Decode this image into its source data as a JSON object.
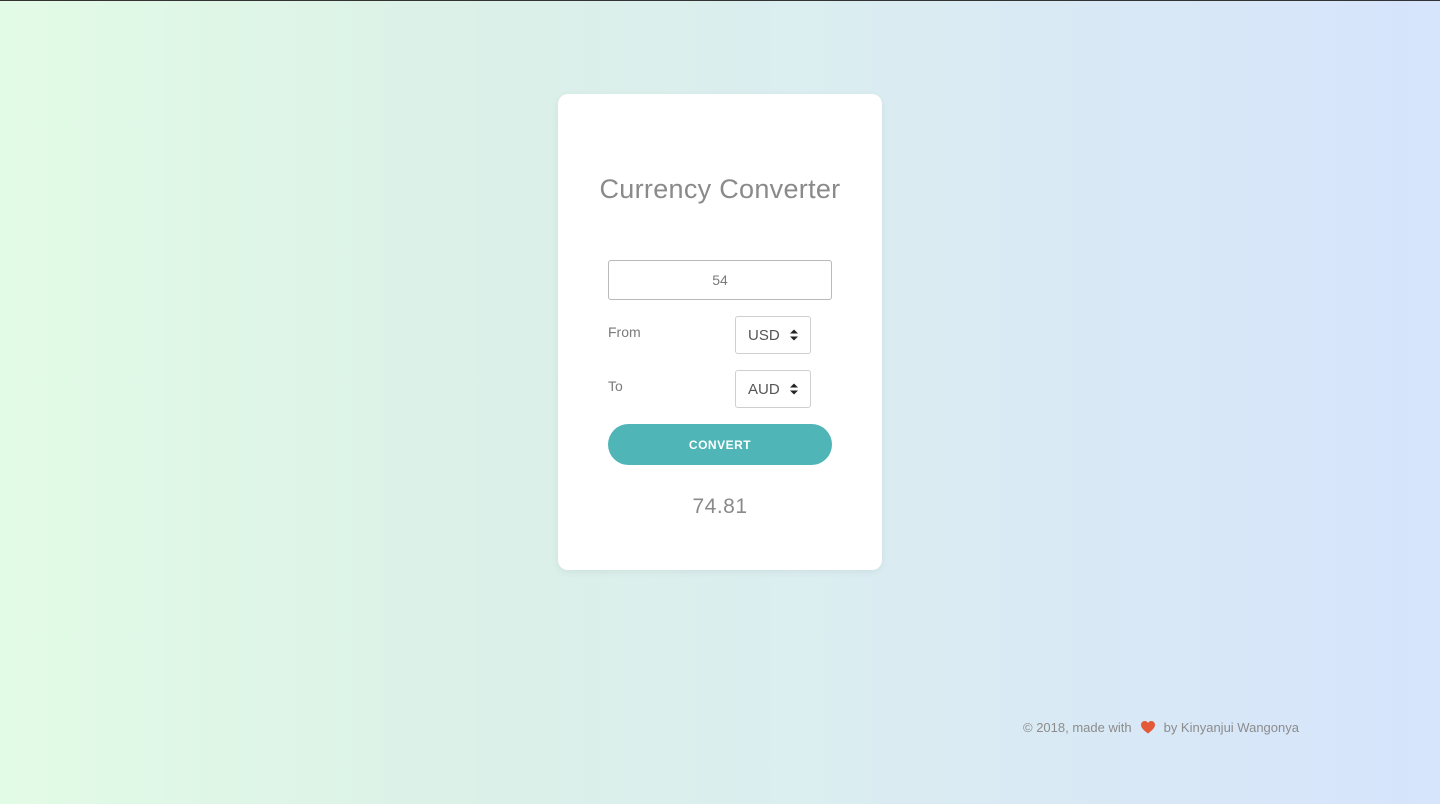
{
  "converter": {
    "title": "Currency Converter",
    "amount_value": "54",
    "from_label": "From",
    "from_currency": "USD",
    "to_label": "To",
    "to_currency": "AUD",
    "convert_label": "CONVERT",
    "result": "74.81"
  },
  "footer": {
    "prefix": "© 2018, made with",
    "heart_icon": "heart-icon",
    "suffix": "by Kinyanjui Wangonya"
  },
  "colors": {
    "accent": "#4fb5b7",
    "heart": "#e25a38",
    "card_background": "#ffffff"
  }
}
